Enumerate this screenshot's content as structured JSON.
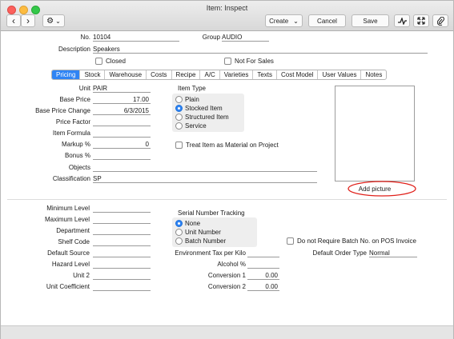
{
  "window": {
    "title": "Item: Inspect"
  },
  "toolbar": {
    "back": "‹",
    "forward": "›",
    "gear": "⚙",
    "gear_caret": "⌄",
    "create_label": "Create",
    "create_caret": "⌄",
    "cancel_label": "Cancel",
    "save_label": "Save"
  },
  "header": {
    "no_label": "No.",
    "no_value": "10104",
    "group_label": "Group",
    "group_value": "AUDIO",
    "description_label": "Description",
    "description_value": "Speakers",
    "closed_label": "Closed",
    "not_for_sales_label": "Not For Sales"
  },
  "tabs": [
    {
      "label": "Pricing",
      "active": true
    },
    {
      "label": "Stock"
    },
    {
      "label": "Warehouse"
    },
    {
      "label": "Costs"
    },
    {
      "label": "Recipe"
    },
    {
      "label": "A/C"
    },
    {
      "label": "Varieties"
    },
    {
      "label": "Texts"
    },
    {
      "label": "Cost Model"
    },
    {
      "label": "User Values"
    },
    {
      "label": "Notes"
    }
  ],
  "pricing": {
    "unit_label": "Unit",
    "unit_value": "PAIR",
    "base_price_label": "Base Price",
    "base_price_value": "17.00",
    "base_price_change_label": "Base Price Change",
    "base_price_change_value": "6/3/2015",
    "price_factor_label": "Price Factor",
    "price_factor_value": "",
    "item_formula_label": "Item Formula",
    "item_formula_value": "",
    "markup_label": "Markup %",
    "markup_value": "0",
    "bonus_label": "Bonus %",
    "bonus_value": "",
    "objects_label": "Objects",
    "objects_value": "",
    "classification_label": "Classification",
    "classification_value": "SP",
    "item_type_label": "Item Type",
    "item_types": [
      {
        "label": "Plain",
        "selected": false
      },
      {
        "label": "Stocked Item",
        "selected": true
      },
      {
        "label": "Structured Item",
        "selected": false
      },
      {
        "label": "Service",
        "selected": false
      }
    ],
    "treat_as_material_label": "Treat Item as Material on Project",
    "add_picture_label": "Add picture"
  },
  "lower": {
    "minimum_level_label": "Minimum Level",
    "maximum_level_label": "Maximum Level",
    "department_label": "Department",
    "shelf_code_label": "Shelf Code",
    "default_source_label": "Default Source",
    "hazard_level_label": "Hazard Level",
    "unit2_label": "Unit 2",
    "unit_coefficient_label": "Unit Coefficient",
    "serial_tracking_label": "Serial Number Tracking",
    "serial_options": [
      {
        "label": "None",
        "selected": true
      },
      {
        "label": "Unit Number",
        "selected": false
      },
      {
        "label": "Batch Number",
        "selected": false
      }
    ],
    "env_tax_label": "Environment Tax per Kilo",
    "env_tax_value": "",
    "alcohol_label": "Alcohol %",
    "alcohol_value": "",
    "conversion1_label": "Conversion 1",
    "conversion1_value": "0.00",
    "conversion2_label": "Conversion 2",
    "conversion2_value": "0.00",
    "no_batch_label": "Do not Require Batch No. on POS Invoice",
    "default_order_type_label": "Default Order Type",
    "default_order_type_value": "Normal"
  },
  "colors": {
    "accent": "#2f84f4",
    "annotation": "#e0201a"
  }
}
